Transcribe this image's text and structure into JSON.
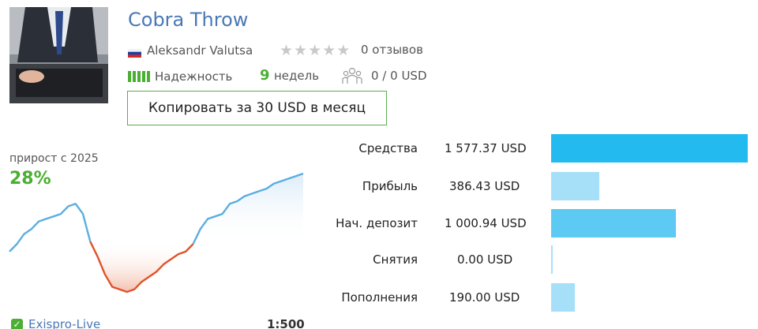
{
  "signal": {
    "title": "Cobra Throw",
    "author": "Aleksandr Valutsa",
    "country_flag": "russia-flag",
    "rating_stars": 0,
    "reviews": "0 отзывов",
    "reliability_label": "Надежность",
    "weeks_number": "9",
    "weeks_label": "недель",
    "subscribers": "0 / 0 USD",
    "copy_button": "Копировать за 30 USD в месяц"
  },
  "growth": {
    "label": "прирост с 2025",
    "value": "28%"
  },
  "account": {
    "broker": "Exispro-Live",
    "leverage": "1:500"
  },
  "stats": [
    {
      "label": "Средства",
      "value": "1 577.37 USD",
      "amount": 1577.37
    },
    {
      "label": "Прибыль",
      "value": "386.43 USD",
      "amount": 386.43
    },
    {
      "label": "Нач. депозит",
      "value": "1 000.94 USD",
      "amount": 1000.94
    },
    {
      "label": "Снятия",
      "value": "0.00 USD",
      "amount": 0.0
    },
    {
      "label": "Пополнения",
      "value": "190.00 USD",
      "amount": 190.0
    }
  ],
  "colors": {
    "title": "#4a78b5",
    "accent_green": "#4aaf32",
    "line_up": "#5aaee0",
    "line_down": "#e0532a",
    "bar_primary": "#23bbef",
    "bar_secondary": "#a6e0f8"
  },
  "chart_data": {
    "type": "line",
    "x": [
      0,
      1,
      2,
      3,
      4,
      5,
      6,
      7,
      8,
      9,
      10,
      11,
      12,
      13,
      14,
      15,
      16,
      17,
      18,
      19,
      20,
      21,
      22,
      23,
      24,
      25,
      26,
      27,
      28,
      29,
      30,
      31,
      32,
      33,
      34,
      35,
      36,
      37,
      38,
      39,
      40
    ],
    "y": [
      -3,
      0,
      4,
      6,
      9,
      10,
      11,
      12,
      15,
      16,
      12,
      1,
      -5,
      -12,
      -17,
      -18,
      -19,
      -18,
      -15,
      -13,
      -11,
      -8,
      -6,
      -4,
      -3,
      0,
      6,
      10,
      11,
      12,
      16,
      17,
      19,
      20,
      21,
      22,
      24,
      25,
      26,
      27,
      28
    ],
    "drawdown_range": [
      11,
      25
    ],
    "y_unit": "%"
  }
}
